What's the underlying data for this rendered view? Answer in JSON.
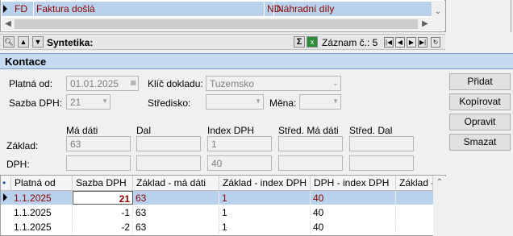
{
  "top_grid": {
    "row": {
      "col1": "FD",
      "col2": "Faktura došlá",
      "col3": "ND",
      "col4": "Náhradní díly"
    }
  },
  "toolbar": {
    "syntetika_label": "Syntetika:",
    "sigma_label": "Σ",
    "record_label": "Záznam č.: 5"
  },
  "section": {
    "title": "Kontace"
  },
  "form": {
    "platna_od_label": "Platná od:",
    "platna_od_value": "01.01.2025",
    "klic_dokladu_label": "Klíč dokladu:",
    "klic_dokladu_value": "Tuzemsko",
    "sazba_dph_label": "Sazba DPH:",
    "sazba_dph_value": "21",
    "stredisko_label": "Středisko:",
    "stredisko_value": "",
    "mena_label": "Měna:",
    "mena_value": "",
    "col_headers": [
      "Má dáti",
      "Dal",
      "Index DPH",
      "Střed. Má dáti",
      "Střed. Dal"
    ],
    "zaklad_label": "Základ:",
    "zaklad_values": [
      "63",
      "",
      "1",
      "",
      ""
    ],
    "dph_label": "DPH:",
    "dph_values": [
      "",
      "",
      "40",
      "",
      ""
    ]
  },
  "buttons": {
    "pridat": "Přidat",
    "kopirovat": "Kopírovat",
    "opravit": "Opravit",
    "smazat": "Smazat"
  },
  "table": {
    "headers": [
      "Platná od",
      "Sazba DPH",
      "Základ - má dáti",
      "Základ - index DPH",
      "DPH - index DPH",
      "Základ -"
    ],
    "header_marker": "•",
    "rows": [
      {
        "platna_od": "1.1.2025",
        "sazba": "21",
        "zaklad_ma_dati": "63",
        "zaklad_index": "1",
        "dph_index": "40",
        "selected": true
      },
      {
        "platna_od": "1.1.2025",
        "sazba": "-1",
        "zaklad_ma_dati": "63",
        "zaklad_index": "1",
        "dph_index": "40",
        "selected": false
      },
      {
        "platna_od": "1.1.2025",
        "sazba": "-2",
        "zaklad_ma_dati": "63",
        "zaklad_index": "1",
        "dph_index": "40",
        "selected": false
      }
    ]
  },
  "colors": {
    "row_text": "#8b0000",
    "selection": "#b9d1ea",
    "section_bg": "#c5daf0"
  }
}
